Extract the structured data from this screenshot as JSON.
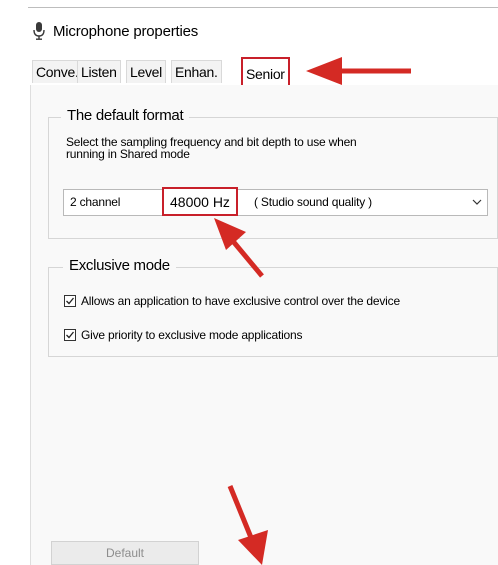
{
  "window": {
    "title": "Microphone properties",
    "icon": "microphone-icon"
  },
  "tabs": [
    {
      "label": "Conve..",
      "active": false
    },
    {
      "label": "Listen",
      "active": false
    },
    {
      "label": "Level",
      "active": false
    },
    {
      "label": "Enhan.",
      "active": false
    },
    {
      "label": "Senior",
      "active": true
    }
  ],
  "default_format": {
    "legend": "The default format",
    "description_line1": "Select the sampling frequency and bit depth to use when",
    "description_line2": "running in Shared mode",
    "select": {
      "channel": "2 channel",
      "rate": "48000 Hz",
      "quality": "( Studio sound quality )"
    }
  },
  "exclusive_mode": {
    "legend": "Exclusive mode",
    "options": [
      {
        "label": "Allows an application to have exclusive control over the device",
        "checked": true
      },
      {
        "label": "Give priority to exclusive mode applications",
        "checked": true
      }
    ]
  },
  "buttons": {
    "default_label": "Default"
  },
  "colors": {
    "highlight": "#c8202a",
    "annotation_arrow": "#d42a24",
    "panel_bg": "#f9f9f9"
  }
}
